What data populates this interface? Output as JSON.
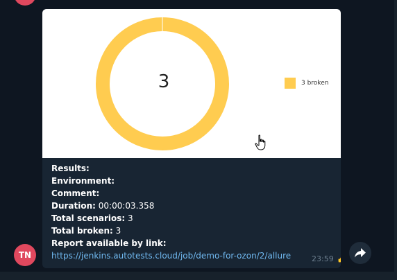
{
  "message": {
    "avatar_initials": "TN",
    "time": "23:59",
    "reaction_icon": "thumbs-up-icon",
    "share_icon": "share-arrow-icon",
    "results_label": "Results:",
    "environment_label": "Environment:",
    "comment_label": "Comment:",
    "duration_label": "Duration:",
    "duration_value": " 00:00:03.358",
    "scenarios_label": "Total scenarios:",
    "scenarios_value": " 3",
    "broken_label": "Total broken:",
    "broken_value": " 3",
    "report_label": "Report available by link:",
    "report_link": "https://jenkins.autotests.cloud/job/demo-for-ozon/2/allure"
  },
  "chart_data": {
    "type": "pie",
    "subtype": "donut",
    "center_label": "3",
    "slices": [
      {
        "label": "3 broken",
        "value": 3,
        "color": "#ffcc50"
      }
    ],
    "legend_position": "right"
  },
  "colors": {
    "background": "#0e1621",
    "bubble": "#182533",
    "avatar": "#e0485e",
    "link": "#71baf2",
    "broken": "#ffcc50"
  }
}
